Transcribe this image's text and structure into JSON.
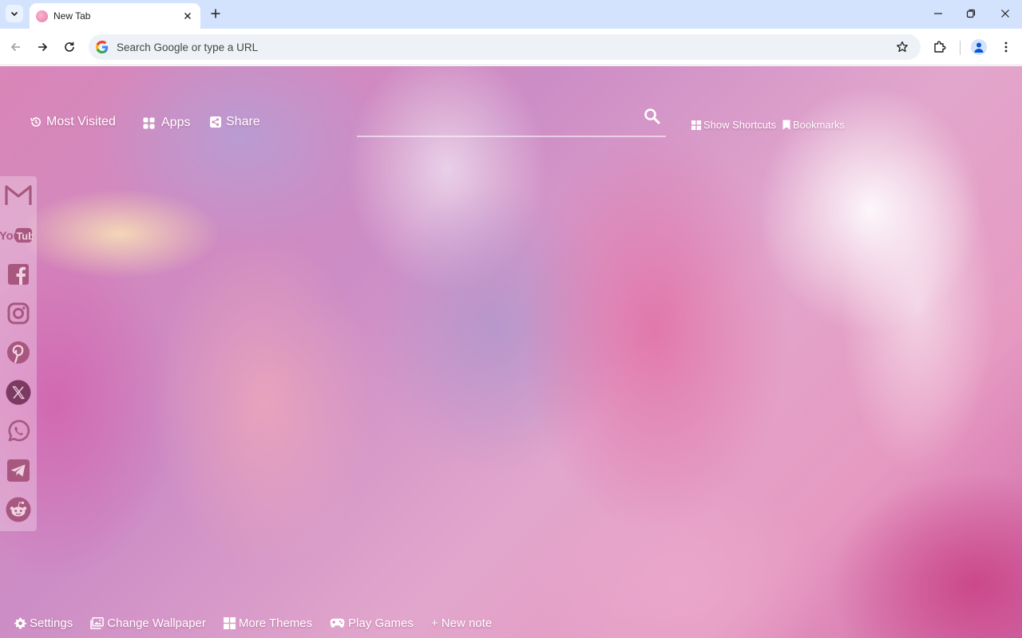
{
  "tab": {
    "title": "New Tab"
  },
  "omnibox": {
    "placeholder": "Search Google or type a URL"
  },
  "top_nav": {
    "most_visited": "Most Visited",
    "apps": "Apps",
    "share": "Share",
    "show_shortcuts": "Show Shortcuts",
    "bookmarks": "Bookmarks"
  },
  "search": {
    "value": ""
  },
  "social_links": [
    "gmail-icon",
    "youtube-icon",
    "facebook-icon",
    "instagram-icon",
    "pinterest-icon",
    "x-icon",
    "whatsapp-icon",
    "telegram-icon",
    "reddit-icon"
  ],
  "youtube_logo": "You Tube",
  "bottom_bar": {
    "settings": "Settings",
    "change_wallpaper": "Change Wallpaper",
    "more_themes": "More Themes",
    "play_games": "Play Games",
    "new_note": "+ New note"
  },
  "colors": {
    "tabstrip": "#d3e3fd",
    "accent": "#0b57d0",
    "social_icon": "#a8577f"
  }
}
